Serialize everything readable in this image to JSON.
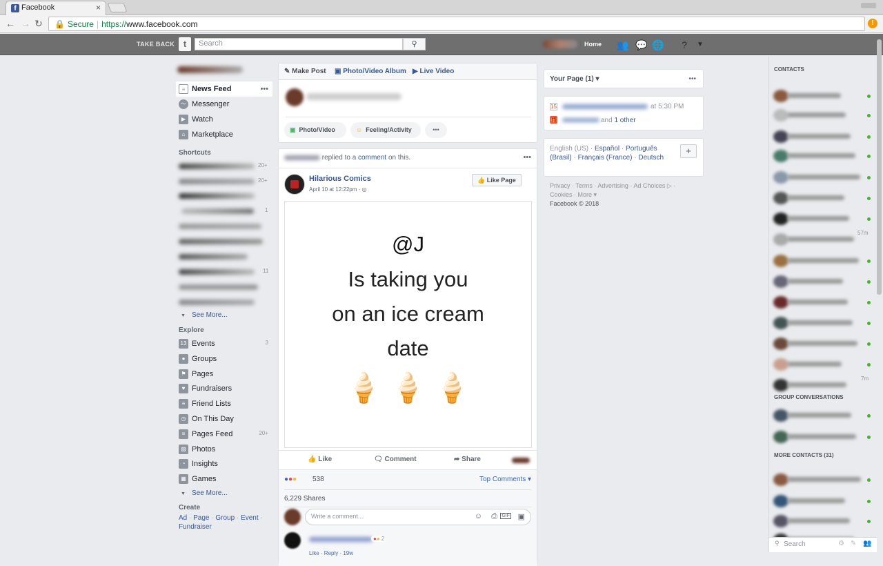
{
  "browser": {
    "tab_title": "Facebook",
    "tab_close": "×",
    "secure_label": "Secure",
    "url_protocol": "https://",
    "url_host": "www.facebook.com"
  },
  "topbar": {
    "take_back": "TAKE BACK",
    "logo": "t",
    "search_placeholder": "Search",
    "home": "Home"
  },
  "left_nav": {
    "main": [
      {
        "label": "News Feed",
        "icon": "news-feed-icon"
      },
      {
        "label": "Messenger",
        "icon": "messenger-icon"
      },
      {
        "label": "Watch",
        "icon": "watch-icon"
      },
      {
        "label": "Marketplace",
        "icon": "marketplace-icon"
      }
    ],
    "shortcuts_title": "Shortcuts",
    "shortcut_counts": [
      "20+",
      "20+",
      "",
      "1",
      "",
      "",
      "",
      "11",
      "",
      ""
    ],
    "see_more": "See More...",
    "explore_title": "Explore",
    "explore": [
      {
        "label": "Events",
        "count": "3",
        "icon": "calendar-icon"
      },
      {
        "label": "Groups",
        "count": "",
        "icon": "groups-icon"
      },
      {
        "label": "Pages",
        "count": "",
        "icon": "flag-icon"
      },
      {
        "label": "Fundraisers",
        "count": "",
        "icon": "heart-icon"
      },
      {
        "label": "Friend Lists",
        "count": "",
        "icon": "friend-list-icon"
      },
      {
        "label": "On This Day",
        "count": "",
        "icon": "clock-icon"
      },
      {
        "label": "Pages Feed",
        "count": "20+",
        "icon": "pages-feed-icon"
      },
      {
        "label": "Photos",
        "count": "",
        "icon": "photos-icon"
      },
      {
        "label": "Insights",
        "count": "",
        "icon": "insights-icon"
      },
      {
        "label": "Games",
        "count": "",
        "icon": "games-icon"
      }
    ],
    "see_more_2": "See More...",
    "create_title": "Create",
    "create_links": [
      "Ad",
      "Page",
      "Group",
      "Event",
      "Fundraiser"
    ]
  },
  "composer": {
    "tabs": [
      "Make Post",
      "Photo/Video Album",
      "Live Video"
    ],
    "actions": [
      "Photo/Video",
      "Feeling/Activity"
    ],
    "more": "•••"
  },
  "post": {
    "context_suffix": " replied to a ",
    "context_link": "comment",
    "context_end": " on this.",
    "page_name": "Hilarious Comics",
    "date": "April 10 at 12:22pm · ",
    "like_page": "Like Page",
    "image_text": [
      "@J",
      "Is taking you",
      "on an ice cream",
      "date"
    ],
    "image_emoji": "🍦 🍦 🍦",
    "actions": [
      "Like",
      "Comment",
      "Share"
    ],
    "reaction_count": "538",
    "top_comments": "Top Comments ▾",
    "shares": "6,229 Shares",
    "comment_placeholder": "Write a comment...",
    "reply_reactions": "2",
    "reply_actions": "Like · Reply · 19w"
  },
  "right_col": {
    "your_page": "Your Page (1) ▾",
    "event_time": "at 5:30 PM",
    "birthday_and": "and ",
    "birthday_other": "1 other",
    "lang_current": "English (US) · ",
    "lang_es": "Español",
    "lang_pt": "Português (Brasil)",
    "lang_fr": "Français (France)",
    "lang_de": "Deutsch",
    "footer_1": "Privacy · Terms · Advertising · Ad Choices ▷ ·",
    "footer_2": "Cookies · More ▾",
    "footer_3": "Facebook © 2018"
  },
  "chat": {
    "contacts_title": "CONTACTS",
    "group_title": "GROUP CONVERSATIONS",
    "more_title": "MORE CONTACTS (31)",
    "times": [
      "57m",
      "7m"
    ],
    "search": "Search"
  },
  "colors": {
    "brand": "#3b5998",
    "link": "#365899",
    "online": "#42b72a"
  }
}
